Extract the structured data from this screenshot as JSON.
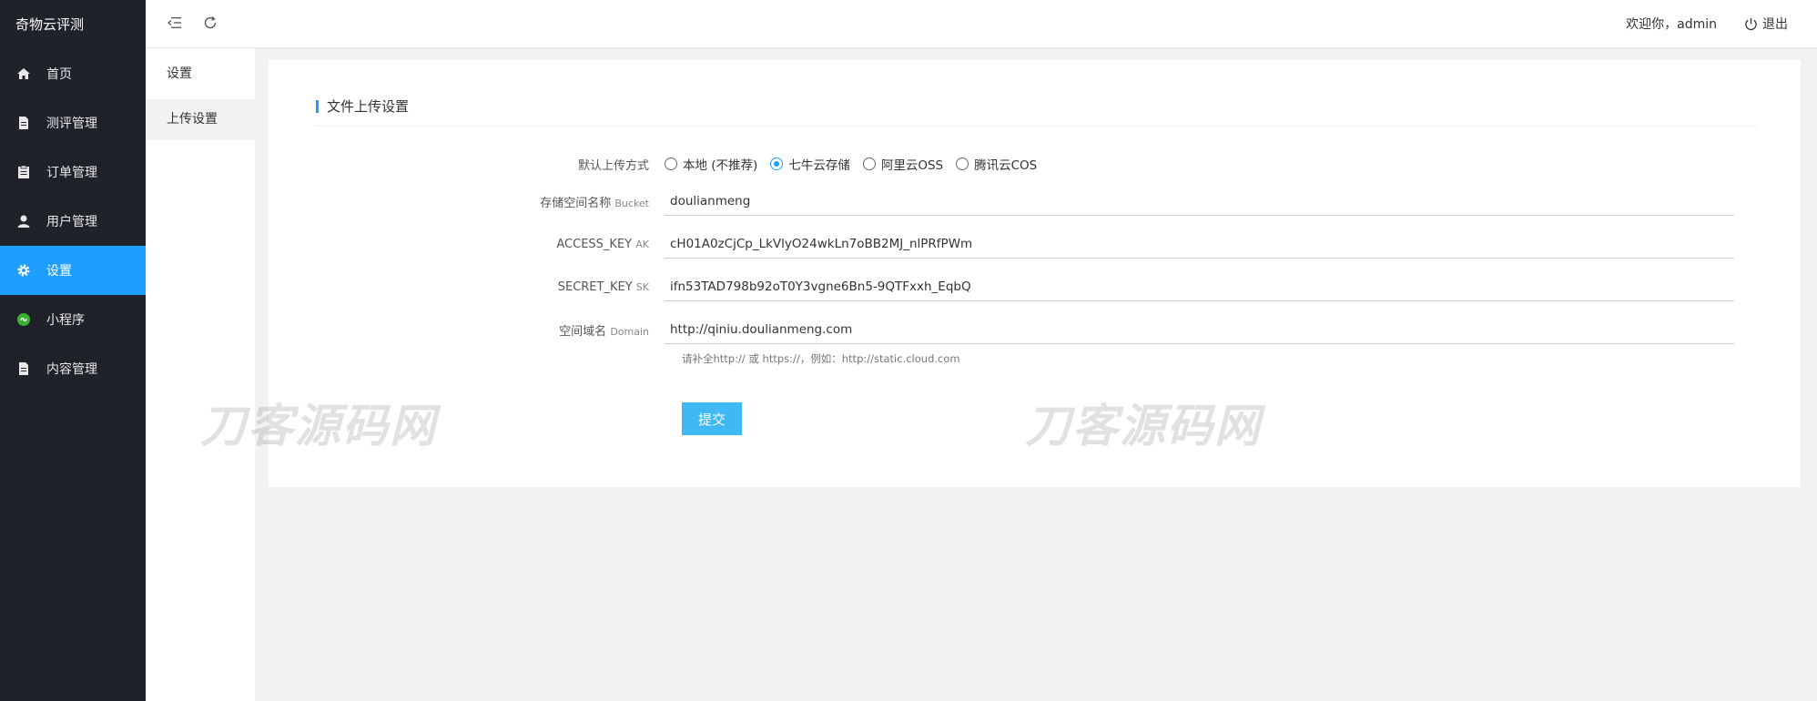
{
  "brand": "奇物云评测",
  "sidebar": {
    "items": [
      {
        "label": "首页",
        "icon": "home-icon"
      },
      {
        "label": "测评管理",
        "icon": "document-icon"
      },
      {
        "label": "订单管理",
        "icon": "clipboard-icon"
      },
      {
        "label": "用户管理",
        "icon": "user-icon"
      },
      {
        "label": "设置",
        "icon": "gear-icon",
        "active": true
      },
      {
        "label": "小程序",
        "icon": "miniprogram-icon"
      },
      {
        "label": "内容管理",
        "icon": "document-icon"
      }
    ]
  },
  "header": {
    "welcome": "欢迎你，admin",
    "logout": "退出"
  },
  "submenu": {
    "title": "设置",
    "items": [
      {
        "label": "上传设置"
      }
    ]
  },
  "form": {
    "title": "文件上传设置",
    "upload_method": {
      "label": "默认上传方式",
      "options": [
        "本地 (不推荐)",
        "七牛云存储",
        "阿里云OSS",
        "腾讯云COS"
      ],
      "selected": "七牛云存储"
    },
    "bucket": {
      "label": "存储空间名称",
      "sub": "Bucket",
      "value": "doulianmeng"
    },
    "access_key": {
      "label": "ACCESS_KEY",
      "sub": "AK",
      "value": "cH01A0zCjCp_LkVlyO24wkLn7oBB2MJ_nlPRfPWm"
    },
    "secret_key": {
      "label": "SECRET_KEY",
      "sub": "SK",
      "value": "ifn53TAD798b92oT0Y3vgne6Bn5-9QTFxxh_EqbQ"
    },
    "domain": {
      "label": "空间域名",
      "sub": "Domain",
      "value": "http://qiniu.doulianmeng.com",
      "hint": "请补全http:// 或 https://，例如：http://static.cloud.com"
    },
    "submit": "提交"
  },
  "watermark": "刀客源码网",
  "colors": {
    "accent": "#1e9fff",
    "sidebar_bg": "#20222a",
    "submit_bg": "#3fb8f4"
  }
}
